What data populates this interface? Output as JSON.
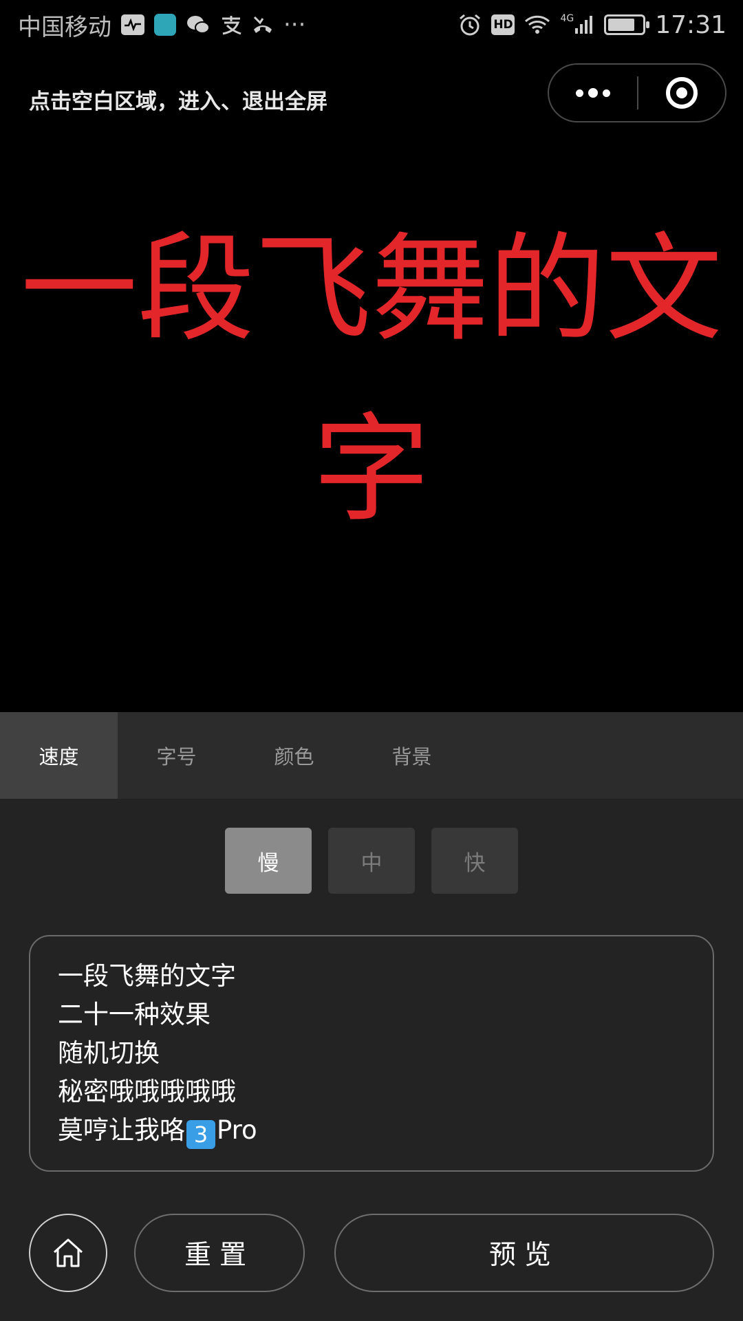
{
  "status_bar": {
    "carrier": "中国移动",
    "network": "4G",
    "time": "17:31",
    "hd_label": "HD",
    "more": "···"
  },
  "header": {
    "hint": "点击空白区域，进入、退出全屏"
  },
  "display": {
    "text": "一段飞舞的文字",
    "color": "#e3262a"
  },
  "tabs": [
    {
      "label": "速度",
      "active": true
    },
    {
      "label": "字号",
      "active": false
    },
    {
      "label": "颜色",
      "active": false
    },
    {
      "label": "背景",
      "active": false
    }
  ],
  "speed_options": [
    {
      "label": "慢",
      "active": true
    },
    {
      "label": "中",
      "active": false
    },
    {
      "label": "快",
      "active": false
    }
  ],
  "text_input": {
    "lines": [
      "一段飞舞的文字",
      "二十一种效果",
      "随机切换",
      "秘密哦哦哦哦哦",
      "莫哼让我咯"
    ],
    "last_line_emoji": "3",
    "last_line_suffix": "Pro"
  },
  "buttons": {
    "reset": "重置",
    "preview": "预览"
  }
}
